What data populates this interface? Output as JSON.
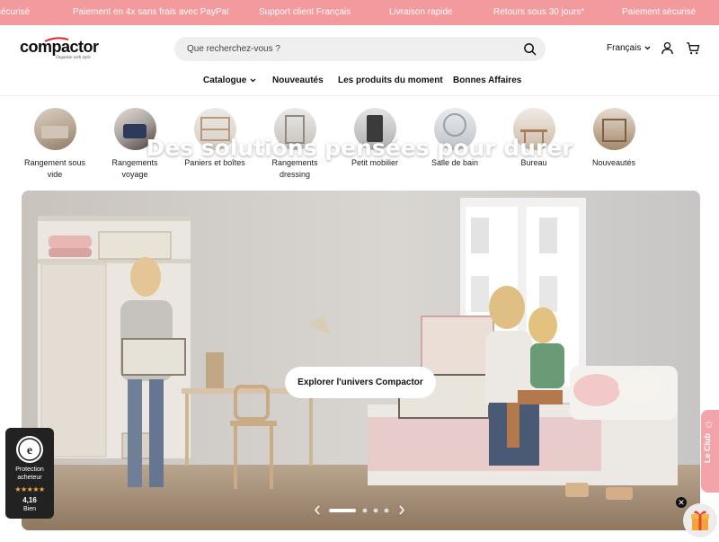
{
  "banner": {
    "messages": [
      "sécurisé",
      "Paiement en 4x sans frais avec PayPal",
      "Support client Français",
      "Livraison rapide",
      "Retours sous 30 jours*",
      "Paiement sécurisé"
    ]
  },
  "header": {
    "logo_text": "compactor",
    "logo_tagline": "Organize with style",
    "search_placeholder": "Que recherchez-vous ?",
    "language": "Français"
  },
  "nav": {
    "items": [
      "Catalogue",
      "Nouveautés",
      "Les produits du moment",
      "Bonnes Affaires"
    ]
  },
  "categories": [
    {
      "line1": "Rangement sous",
      "line2": "vide"
    },
    {
      "line1": "Rangements",
      "line2": "voyage"
    },
    {
      "line1": "Paniers et boîtes",
      "line2": ""
    },
    {
      "line1": "Rangements",
      "line2": "dressing"
    },
    {
      "line1": "Petit mobilier",
      "line2": ""
    },
    {
      "line1": "Salle de bain",
      "line2": ""
    },
    {
      "line1": "Bureau",
      "line2": ""
    },
    {
      "line1": "Nouveautés",
      "line2": ""
    }
  ],
  "hero": {
    "title": "Des solutions pensées pour durer",
    "button": "Explorer l'univers Compactor",
    "slides_total": 4,
    "active_slide": 1
  },
  "trust_badge": {
    "line1": "Protection",
    "line2": "acheteur",
    "stars": "★★★★★",
    "score": "4,16",
    "label": "Bien"
  },
  "club": {
    "label": "Le Club"
  },
  "colors": {
    "banner_bg": "#f29a9d",
    "club_bg": "#f3a4a8",
    "text_dark": "#111111",
    "search_bg": "#efefef"
  }
}
